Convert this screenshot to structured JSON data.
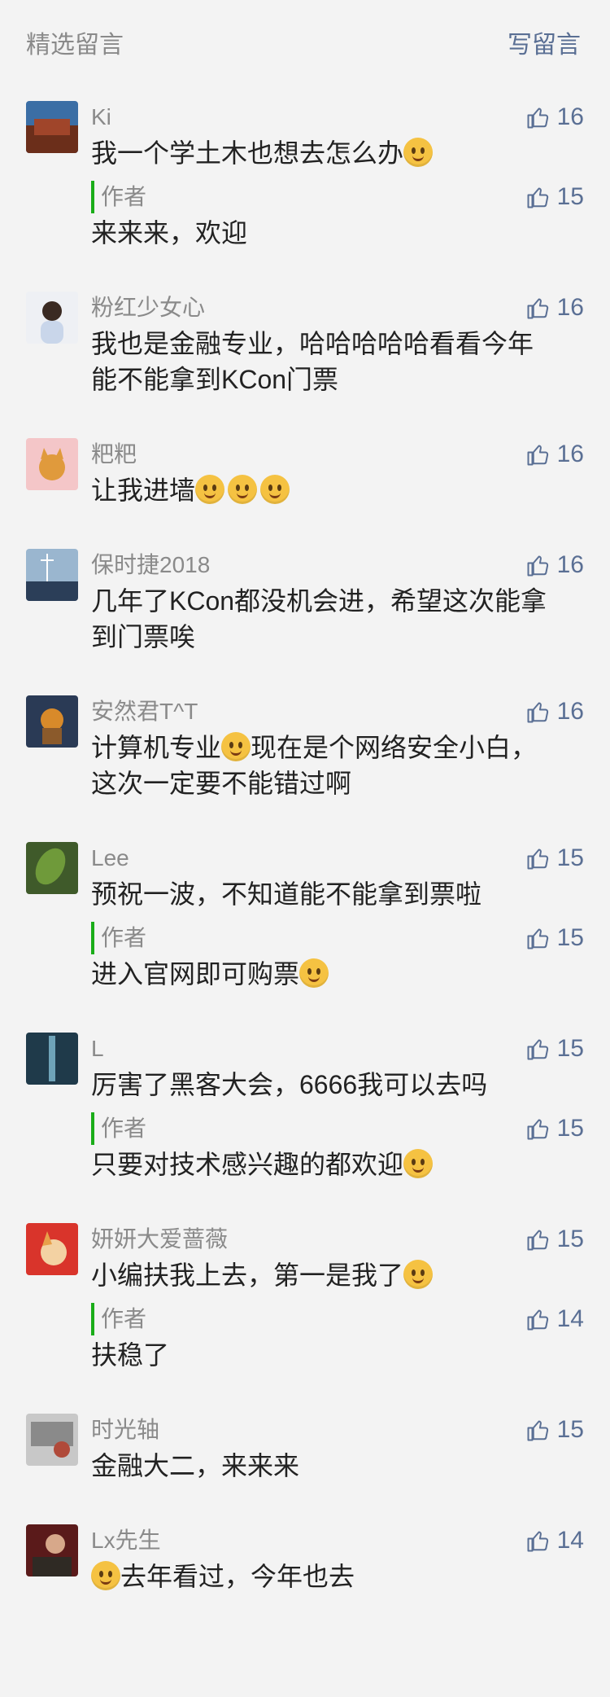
{
  "header": {
    "title": "精选留言",
    "write": "写留言"
  },
  "comments": [
    {
      "name": "Ki",
      "text": "我一个学土木也想去怎么办",
      "emoji_after": 1,
      "likes": "16",
      "reply": {
        "label": "作者",
        "text": "来来来，欢迎",
        "likes": "15"
      }
    },
    {
      "name": "粉红少女心",
      "text": "我也是金融专业，哈哈哈哈哈看看今年能不能拿到KCon门票",
      "likes": "16"
    },
    {
      "name": "粑粑",
      "text": "让我进墙",
      "emoji_after": 3,
      "likes": "16"
    },
    {
      "name": "保时捷2018",
      "text": "几年了KCon都没机会进，希望这次能拿到门票唉",
      "likes": "16"
    },
    {
      "name": "安然君T^T",
      "text_a": "计算机专业",
      "text_b": "现在是个网络安全小白，这次一定要不能错过啊",
      "likes": "16"
    },
    {
      "name": "Lee",
      "text": "预祝一波，不知道能不能拿到票啦",
      "likes": "15",
      "reply": {
        "label": "作者",
        "text": "进入官网即可购票",
        "likes": "15"
      }
    },
    {
      "name": "L",
      "text": "厉害了黑客大会，6666我可以去吗",
      "likes": "15",
      "reply": {
        "label": "作者",
        "text": "只要对技术感兴趣的都欢迎",
        "likes": "15"
      }
    },
    {
      "name": "妍妍大爱蔷薇",
      "text": "小编扶我上去，第一是我了",
      "likes": "15",
      "reply": {
        "label": "作者",
        "text": "扶稳了",
        "likes": "14"
      }
    },
    {
      "name": "时光轴",
      "text": "金融大二，来来来",
      "likes": "15"
    },
    {
      "name": "Lx先生",
      "text": "去年看过，今年也去",
      "likes": "14"
    }
  ],
  "colors": {
    "accent": "#5a6f94",
    "author_bar": "#1aad19",
    "background": "#f3f3f3"
  },
  "icons": {
    "like": "thumbs-up-icon",
    "emoji": "smiley-emoji"
  }
}
